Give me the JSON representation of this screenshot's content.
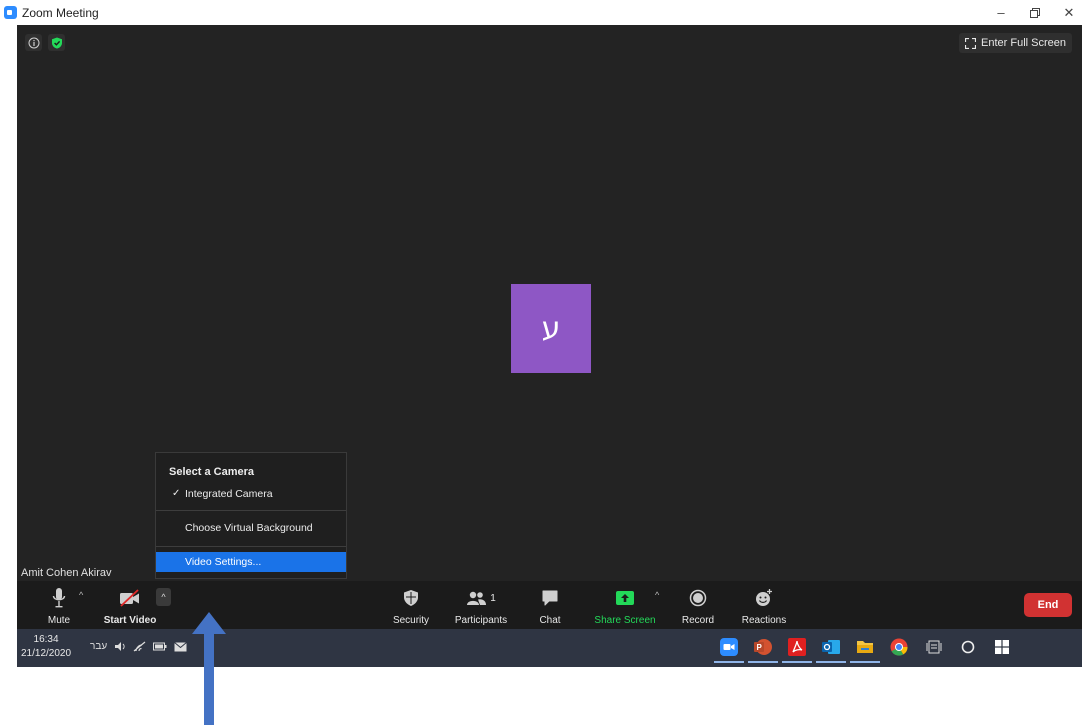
{
  "window": {
    "title": "Zoom Meeting"
  },
  "meeting": {
    "fullscreen_label": "Enter Full Screen",
    "avatar_letter": "ע",
    "participant_name": "Amit Cohen Akirav"
  },
  "camera_menu": {
    "header": "Select a Camera",
    "items": [
      {
        "label": "Integrated Camera",
        "checked": true
      },
      {
        "label": "Choose Virtual Background"
      },
      {
        "label": "Video Settings...",
        "selected": true
      }
    ]
  },
  "toolbar": {
    "mute_label": "Mute",
    "start_video_label": "Start Video",
    "security_label": "Security",
    "participants_label": "Participants",
    "participants_count": "1",
    "chat_label": "Chat",
    "share_screen_label": "Share Screen",
    "record_label": "Record",
    "reactions_label": "Reactions",
    "end_label": "End"
  },
  "taskbar": {
    "time": "16:34",
    "date": "21/12/2020",
    "lang": "עבר"
  },
  "colors": {
    "accent_blue": "#1a73e8",
    "end_red": "#d13232",
    "share_green": "#23d959",
    "avatar_purple": "#8e57c5",
    "arrow_blue": "#4472c4"
  }
}
